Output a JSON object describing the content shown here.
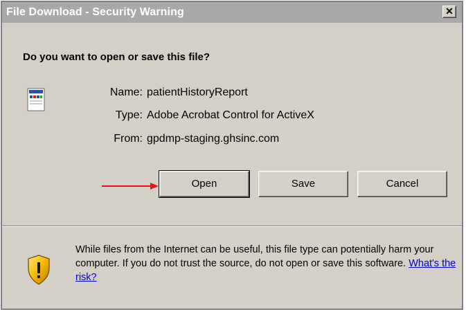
{
  "window": {
    "title": "File Download - Security Warning",
    "close_label": "✕"
  },
  "question": "Do you want to open or save this file?",
  "file": {
    "name_label": "Name:",
    "name": "patientHistoryReport",
    "type_label": "Type:",
    "type": "Adobe Acrobat Control for ActiveX",
    "from_label": "From:",
    "from": "gpdmp-staging.ghsinc.com",
    "icon": "document-icon"
  },
  "buttons": {
    "open": "Open",
    "save": "Save",
    "cancel": "Cancel"
  },
  "warning": {
    "text": "While files from the Internet can be useful, this file type can potentially harm your computer. If you do not trust the source, do not open or save this software.",
    "link": "What's the risk?",
    "icon": "shield-warning-icon"
  },
  "colors": {
    "dialog_bg": "#d4d0c8",
    "titlebar_bg": "#a9a9a9",
    "arrow": "#e8101b",
    "link": "#0000cc"
  }
}
